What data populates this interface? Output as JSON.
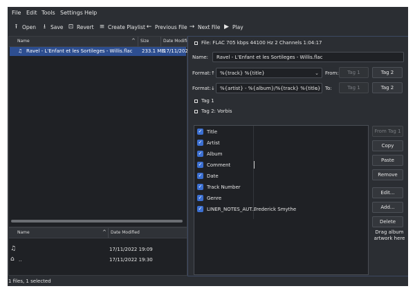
{
  "menu": [
    "File",
    "Edit",
    "Tools",
    "Settings",
    "Help"
  ],
  "toolbar": {
    "open": "Open",
    "save": "Save",
    "revert": "Revert",
    "create_playlist": "Create Playlist",
    "previous_file": "Previous File",
    "next_file": "Next File",
    "play": "Play"
  },
  "filelist": {
    "col_name": "Name",
    "col_size": "Size",
    "col_date": "Date Modified",
    "row": {
      "name": "Ravel - L'Enfant et les Sortileges - Willis.flac",
      "size": "233.1 MB",
      "date": "17/11/2022"
    }
  },
  "dirlist": {
    "col_name": "Name",
    "col_date": "Date Modified",
    "rows": [
      {
        "name": "",
        "date": "17/11/2022 19:09"
      },
      {
        "name": "..",
        "date": "17/11/2022 19:30"
      }
    ]
  },
  "status": "1 files, 1 selected",
  "file_info": "File: FLAC 705 kbps 44100 Hz 2 Channels 1:04:17",
  "name_label": "Name:",
  "name_value": "Ravel - L'Enfant et les Sortileges - Willis.flac",
  "format_up_label": "Format:↑",
  "format_up_value": "%{track} %{title}",
  "from_label": "From:",
  "format_down_label": "Format:↓",
  "format_down_value": "%{artist} - %{album}/%{track} %{title}",
  "to_label": "To:",
  "tag1_button": "Tag 1",
  "tag2_button": "Tag 2",
  "tag1_section": "Tag 1",
  "tag2_section": "Tag 2: Vorbis",
  "tags": [
    {
      "name": "Title",
      "value": ""
    },
    {
      "name": "Artist",
      "value": ""
    },
    {
      "name": "Album",
      "value": ""
    },
    {
      "name": "Comment",
      "value": ""
    },
    {
      "name": "Date",
      "value": ""
    },
    {
      "name": "Track Number",
      "value": ""
    },
    {
      "name": "Genre",
      "value": ""
    },
    {
      "name": "LINER_NOTES_AUT...",
      "value": "Frederick Smythe"
    }
  ],
  "buttons": {
    "from_tag1": "From Tag 1",
    "copy": "Copy",
    "paste": "Paste",
    "remove": "Remove",
    "edit": "Edit...",
    "add": "Add...",
    "delete": "Delete"
  },
  "drag_artwork": "Drag album artwork here",
  "colors": {
    "bg": "#2b2e33",
    "field": "#1f2125",
    "selection": "#2d4e90",
    "accent": "#3b6fd1"
  }
}
